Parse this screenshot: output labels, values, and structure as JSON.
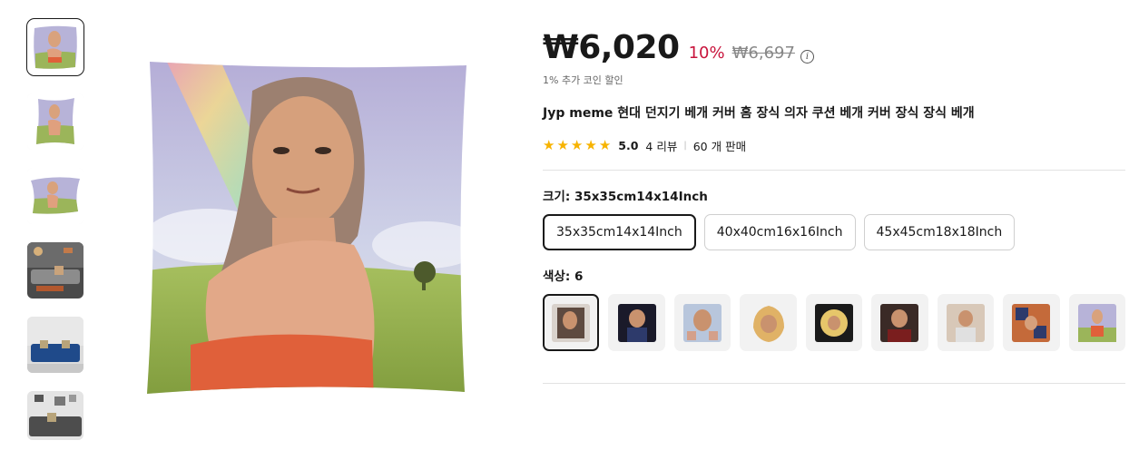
{
  "product": {
    "price": "₩6,020",
    "discount": "10%",
    "original_price": "₩6,697",
    "coin_note": "1% 추가 코인 할인",
    "title": "Jyp meme 현대 던지기 베개 커버 홈 장식 의자 쿠션 베개 커버 장식 장식 베개",
    "rating": "5.0",
    "reviews": "4 리뷰",
    "sales": "60 개 판매"
  },
  "options": {
    "size_label": "크기: 35x35cm14x14Inch",
    "sizes": [
      "35x35cm14x14Inch",
      "40x40cm16x16Inch",
      "45x45cm18x18Inch"
    ],
    "color_label": "색상: 6",
    "colors": [
      "color-1",
      "color-2",
      "color-3",
      "color-4",
      "color-5",
      "color-6",
      "color-7",
      "color-8",
      "color-9"
    ]
  },
  "colors": {
    "accent_discount": "#c8143c",
    "star": "#f7b300",
    "text": "#191919"
  },
  "icons": {
    "info": "info-icon",
    "star": "star-icon"
  }
}
